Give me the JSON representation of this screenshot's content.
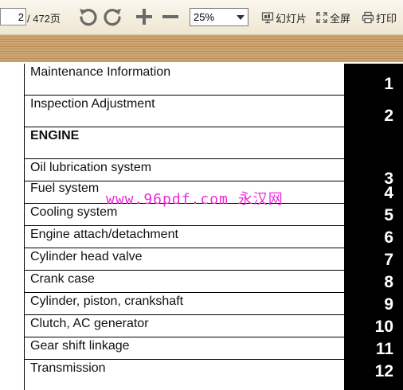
{
  "toolbar": {
    "current_page": "2",
    "page_total": "/ 472页",
    "zoom": "25%",
    "slideshow_label": "幻灯片",
    "fullscreen_label": "全屏",
    "print_label": "打印"
  },
  "document": {
    "rows": [
      {
        "label": "Maintenance Information",
        "bold": false,
        "num": "1"
      },
      {
        "label": "Inspection Adjustment",
        "bold": false,
        "num": "2"
      },
      {
        "label": "ENGINE",
        "bold": true,
        "num": ""
      },
      {
        "label": "Oil lubrication system",
        "bold": false,
        "num": "3"
      },
      {
        "label": "Fuel system",
        "bold": false,
        "num": "4"
      },
      {
        "label": "Cooling system",
        "bold": false,
        "num": "5"
      },
      {
        "label": "Engine attach/detachment",
        "bold": false,
        "num": "6"
      },
      {
        "label": "Cylinder head valve",
        "bold": false,
        "num": "7"
      },
      {
        "label": "Crank case",
        "bold": false,
        "num": "8"
      },
      {
        "label": "Cylinder, piston, crankshaft",
        "bold": false,
        "num": "9"
      },
      {
        "label": "Clutch, AC generator",
        "bold": false,
        "num": "10"
      },
      {
        "label": "Gear shift linkage",
        "bold": false,
        "num": "11"
      },
      {
        "label": "Transmission",
        "bold": false,
        "num": "12"
      }
    ],
    "watermark": "www.96pdf.com 永汉网"
  }
}
